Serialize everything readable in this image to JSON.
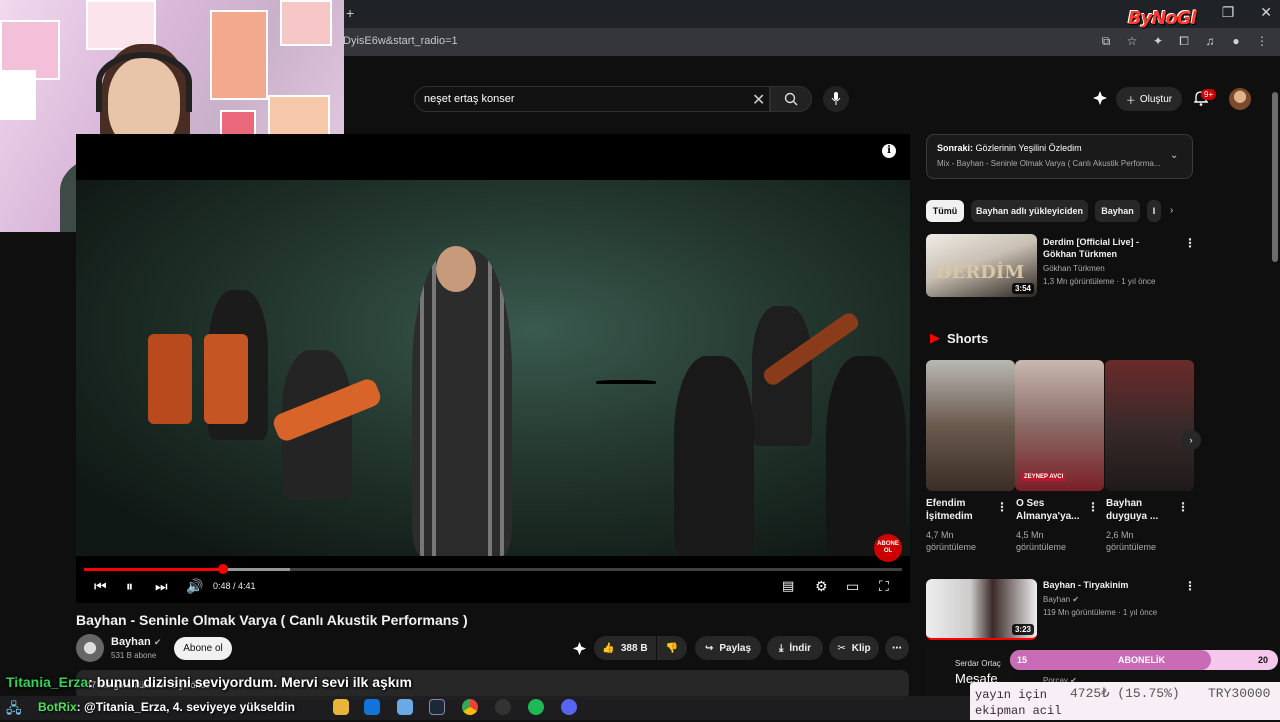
{
  "browser": {
    "url_fragment": "DyisE6w&start_radio=1",
    "new_tab": "+",
    "min": "—",
    "max": "❐",
    "close": "✕",
    "overlay_logo": "ByNoGl"
  },
  "header": {
    "search_value": "neşet ertaş konser",
    "create_label": "Oluştur",
    "notif_badge": "9+"
  },
  "video": {
    "title": "Bayhan - Seninle Olmak Varya ( Canlı Akustik Performans )",
    "time": "0:48 / 4:41",
    "progress_fraction": 0.17,
    "abone_label": "ABONE OL"
  },
  "channel": {
    "name": "Bayhan",
    "subs": "531 B abone",
    "subscribe": "Abone ol"
  },
  "actions": {
    "likes": "388 B",
    "share": "Paylaş",
    "download": "İndir",
    "clip": "Klip"
  },
  "description": {
    "text": "47 Mn görüntüleme · 5 yıl önce"
  },
  "chat": {
    "user": "Titania_Erza",
    "message": ": bunun dizisini seviyordum. Mervi sevi ilk aşkım"
  },
  "taskbar": {
    "bot": "BotRix",
    "message": ": @Titania_Erza, 4. seviyeye yükseldin"
  },
  "upnext": {
    "label": "Sonraki:",
    "title": "Gözlerinin Yeşilini Özledim",
    "sub": "Mix - Bayhan - Seninle Olmak Varya ( Canlı Akustik Performa..."
  },
  "chips": [
    "Tümü",
    "Bayhan adlı yükleyiciden",
    "Bayhan",
    "I"
  ],
  "related": [
    {
      "title": "Derdim [Official Live] - Gökhan Türkmen",
      "channel": "Gökhan Türkmen",
      "meta": "1,3 Mn görüntüleme · 1 yıl önce",
      "duration": "3:54",
      "thumb_text": "DERDİM"
    },
    {
      "title": "Bayhan - Tiryakinim",
      "channel": "Bayhan",
      "meta": "119 Mn görüntüleme · 1 yıl önce",
      "duration": "3:23"
    }
  ],
  "shorts": {
    "heading": "Shorts",
    "items": [
      {
        "title1": "Efendim",
        "title2": "İşitmedim",
        "views1": "4,7 Mn",
        "views2": "görüntüleme"
      },
      {
        "title1": "O Ses",
        "title2": "Almanya'ya...",
        "views1": "4,5 Mn",
        "views2": "görüntüleme",
        "badge": "ZEYNEP AVCI"
      },
      {
        "title1": "Bayhan",
        "title2": "duyguya ...",
        "views1": "2,6 Mn",
        "views2": "görüntüleme"
      }
    ]
  },
  "partial_card": {
    "channel_line": "Serdar Ortaç",
    "title": "Mesafe",
    "channel": "Porçay"
  },
  "subgoal": {
    "left": "15",
    "label": "ABONELİK",
    "right": "20"
  },
  "donation": {
    "line1": "yayın için",
    "line2": "ekipman acil",
    "amount": "4725₺ (15.75%)",
    "target": "TRY30000"
  },
  "colors": {
    "accent": "#ff0000",
    "chat_user": "#34d059",
    "bg": "#0f0f0f"
  }
}
